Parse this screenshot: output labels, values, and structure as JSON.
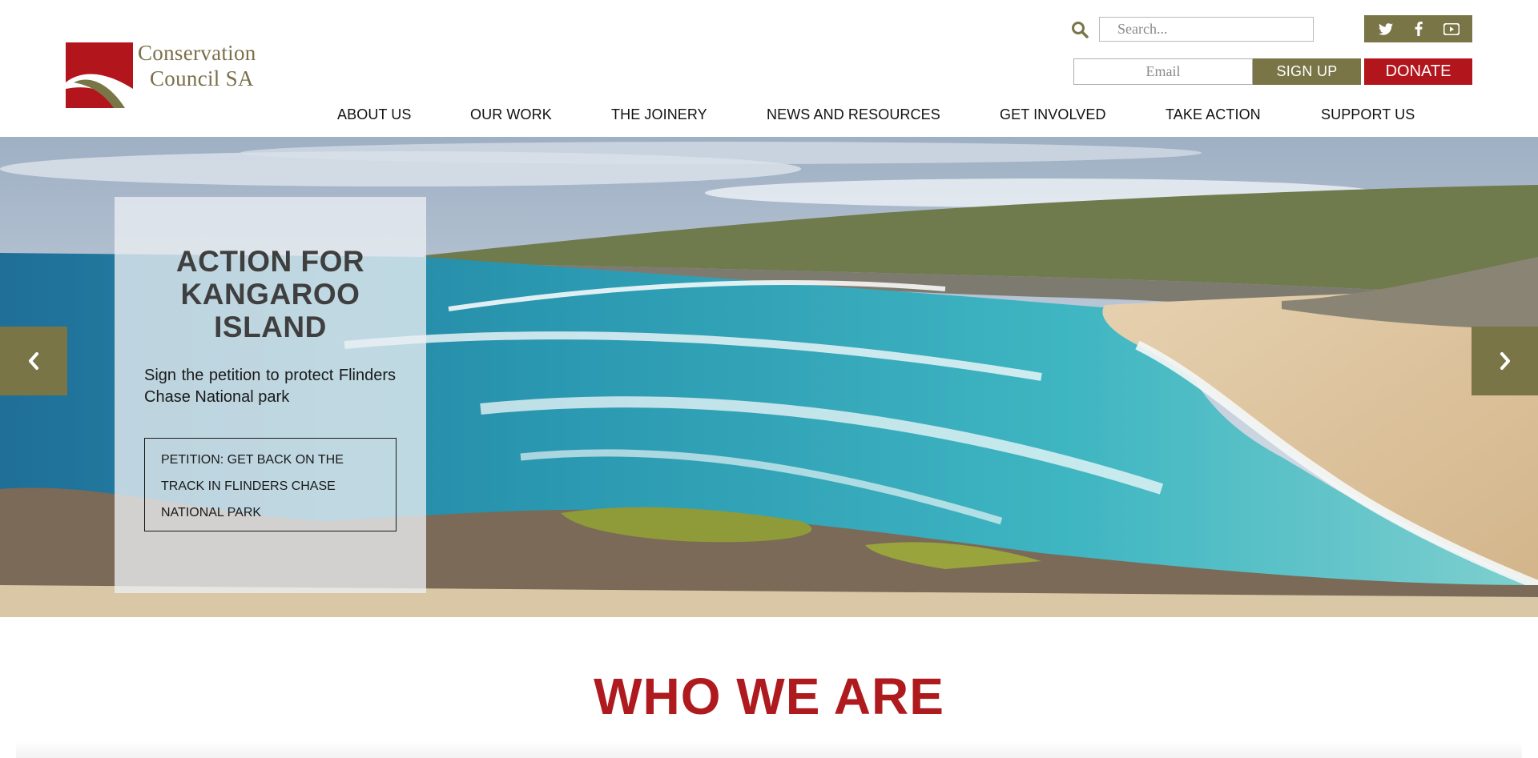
{
  "brand": {
    "line1": "Conservation",
    "line2": "Council SA",
    "logo_red": "#b3151c",
    "logo_olive": "#7a7547"
  },
  "header": {
    "search_placeholder": "Search...",
    "email_placeholder": "Email",
    "signup_label": "SIGN UP",
    "donate_label": "DONATE",
    "social": [
      "twitter-icon",
      "facebook-icon",
      "youtube-icon"
    ]
  },
  "nav": {
    "items": [
      {
        "label": "ABOUT US"
      },
      {
        "label": "OUR WORK"
      },
      {
        "label": "THE JOINERY"
      },
      {
        "label": "NEWS AND RESOURCES"
      },
      {
        "label": "GET INVOLVED"
      },
      {
        "label": "TAKE ACTION"
      },
      {
        "label": "SUPPORT US"
      }
    ]
  },
  "hero": {
    "title_line1": "ACTION FOR",
    "title_line2": "KANGAROO",
    "title_line3": "ISLAND",
    "text": "Sign the petition to protect Flinders Chase National park",
    "cta_label": "PETITION: GET BACK ON THE TRACK IN FLINDERS CHASE NATIONAL PARK",
    "prev_icon": "chevron-left-icon",
    "next_icon": "chevron-right-icon"
  },
  "section": {
    "title": "WHO WE ARE"
  },
  "colors": {
    "olive": "#7a7547",
    "red": "#b3151c",
    "heading_red": "#ae1a1e"
  }
}
